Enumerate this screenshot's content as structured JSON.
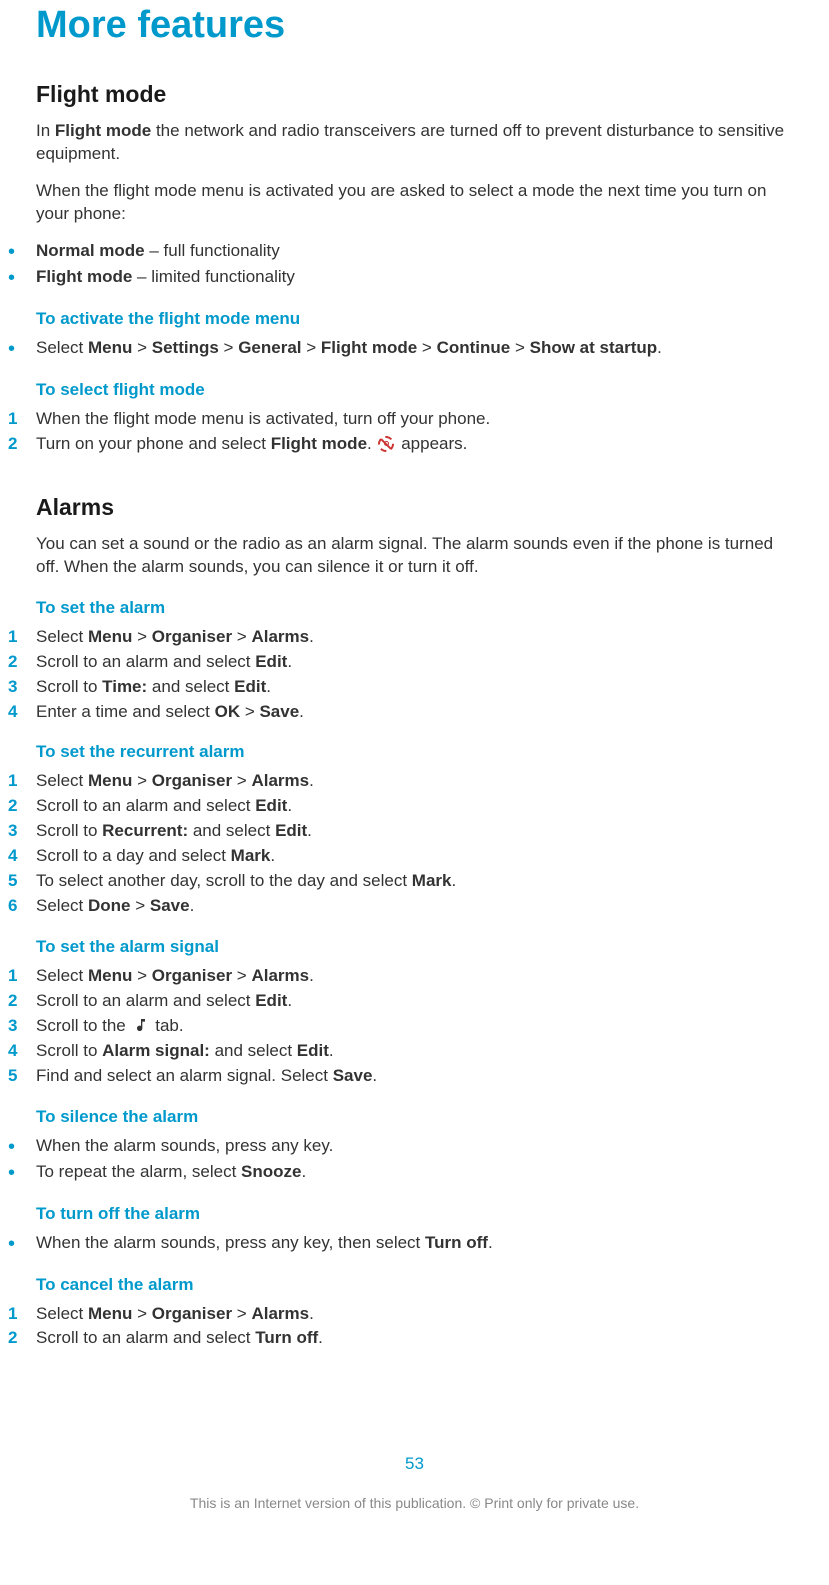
{
  "page_title": "More features",
  "flight_mode": {
    "heading": "Flight mode",
    "para1_prefix": "In ",
    "para1_bold": "Flight mode",
    "para1_suffix": " the network and radio transceivers are turned off to prevent disturbance to sensitive equipment.",
    "para2": "When the flight mode menu is activated you are asked to select a mode the next time you turn on your phone:",
    "modes": [
      {
        "bold": "Normal mode",
        "suffix": " – full functionality"
      },
      {
        "bold": "Flight mode",
        "suffix": " – limited functionality"
      }
    ],
    "activate": {
      "heading": "To activate the flight mode menu",
      "step_prefix": "Select ",
      "path": [
        "Menu",
        "Settings",
        "General",
        "Flight mode",
        "Continue",
        "Show at startup"
      ],
      "suffix": "."
    },
    "select": {
      "heading": "To select flight mode",
      "steps": [
        {
          "n": "1",
          "text": "When the flight mode menu is activated, turn off your phone."
        },
        {
          "n": "2",
          "pre": "Turn on your phone and select ",
          "bold": "Flight mode",
          "post": ". ",
          "icon": "flight",
          "tail": " appears."
        }
      ]
    }
  },
  "alarms": {
    "heading": "Alarms",
    "intro": "You can set a sound or the radio as an alarm signal. The alarm sounds even if the phone is turned off. When the alarm sounds, you can silence it or turn it off.",
    "set_alarm": {
      "heading": "To set the alarm",
      "steps": [
        {
          "n": "1",
          "pre": "Select ",
          "path": [
            "Menu",
            "Organiser",
            "Alarms"
          ],
          "post": "."
        },
        {
          "n": "2",
          "pre": "Scroll to an alarm and select ",
          "bold": "Edit",
          "post": "."
        },
        {
          "n": "3",
          "pre": "Scroll to ",
          "bold": "Time:",
          "mid": " and select ",
          "bold2": "Edit",
          "post": "."
        },
        {
          "n": "4",
          "pre": "Enter a time and select ",
          "bold": "OK",
          "mid": " > ",
          "bold2": "Save",
          "post": "."
        }
      ]
    },
    "recurrent": {
      "heading": "To set the recurrent alarm",
      "steps": [
        {
          "n": "1",
          "pre": "Select ",
          "path": [
            "Menu",
            "Organiser",
            "Alarms"
          ],
          "post": "."
        },
        {
          "n": "2",
          "pre": "Scroll to an alarm and select ",
          "bold": "Edit",
          "post": "."
        },
        {
          "n": "3",
          "pre": "Scroll to ",
          "bold": "Recurrent:",
          "mid": " and select ",
          "bold2": "Edit",
          "post": "."
        },
        {
          "n": "4",
          "pre": "Scroll to a day and select ",
          "bold": "Mark",
          "post": "."
        },
        {
          "n": "5",
          "pre": "To select another day, scroll to the day and select ",
          "bold": "Mark",
          "post": "."
        },
        {
          "n": "6",
          "pre": "Select ",
          "bold": "Done",
          "mid": " > ",
          "bold2": "Save",
          "post": "."
        }
      ]
    },
    "signal": {
      "heading": "To set the alarm signal",
      "steps": [
        {
          "n": "1",
          "pre": "Select ",
          "path": [
            "Menu",
            "Organiser",
            "Alarms"
          ],
          "post": "."
        },
        {
          "n": "2",
          "pre": "Scroll to an alarm and select ",
          "bold": "Edit",
          "post": "."
        },
        {
          "n": "3",
          "pre": "Scroll to the ",
          "icon": "music",
          "post": " tab."
        },
        {
          "n": "4",
          "pre": "Scroll to ",
          "bold": "Alarm signal:",
          "mid": " and select ",
          "bold2": "Edit",
          "post": "."
        },
        {
          "n": "5",
          "pre": "Find and select an alarm signal. Select ",
          "bold": "Save",
          "post": "."
        }
      ]
    },
    "silence": {
      "heading": "To silence the alarm",
      "items": [
        {
          "text": "When the alarm sounds, press any key."
        },
        {
          "pre": "To repeat the alarm, select ",
          "bold": "Snooze",
          "post": "."
        }
      ]
    },
    "turnoff": {
      "heading": "To turn off the alarm",
      "items": [
        {
          "pre": "When the alarm sounds, press any key, then select ",
          "bold": "Turn off",
          "post": "."
        }
      ]
    },
    "cancel": {
      "heading": "To cancel the alarm",
      "steps": [
        {
          "n": "1",
          "pre": "Select ",
          "path": [
            "Menu",
            "Organiser",
            "Alarms"
          ],
          "post": "."
        },
        {
          "n": "2",
          "pre": "Scroll to an alarm and select ",
          "bold": "Turn off",
          "post": "."
        }
      ]
    }
  },
  "footer": {
    "page_num": "53",
    "text": "This is an Internet version of this publication. © Print only for private use."
  }
}
